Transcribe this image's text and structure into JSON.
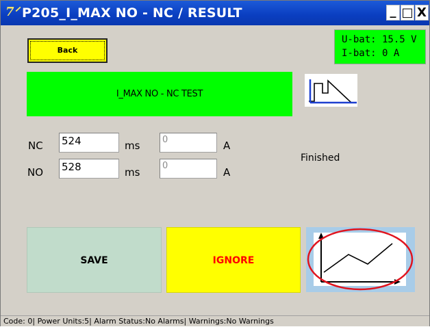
{
  "window": {
    "title": "P205_I_MAX NO - NC / RESULT",
    "icon": "app-logo-icon",
    "minimize_glyph": "_",
    "maximize_glyph": "□",
    "close_glyph": "X"
  },
  "toolbar": {
    "back_label": "Back"
  },
  "status": {
    "u_bat": "U-bat: 15.5 V",
    "i_bat": "I-bat: 0 A"
  },
  "test": {
    "banner": "I_MAX NO - NC TEST",
    "icon": "pulse-ramp-icon"
  },
  "measurements": {
    "nc": {
      "label": "NC",
      "time_value": "524",
      "time_unit": "ms",
      "current_value": "0",
      "current_unit": "A"
    },
    "no": {
      "label": "NO",
      "time_value": "528",
      "time_unit": "ms",
      "current_value": "0",
      "current_unit": "A"
    },
    "state": "Finished"
  },
  "actions": {
    "save_label": "SAVE",
    "ignore_label": "IGNORE",
    "graph_icon": "line-graph-icon",
    "highlight_color": "#e0141e"
  },
  "statusbar": {
    "text": "Code: 0| Power Units:5| Alarm Status:No Alarms| Warnings:No Warnings"
  },
  "colors": {
    "titlebar": "#0a3ec0",
    "green": "#00ff00",
    "yellow": "#ffff00",
    "save_bg": "#c1dccb",
    "graph_bg": "#a8cce8"
  }
}
